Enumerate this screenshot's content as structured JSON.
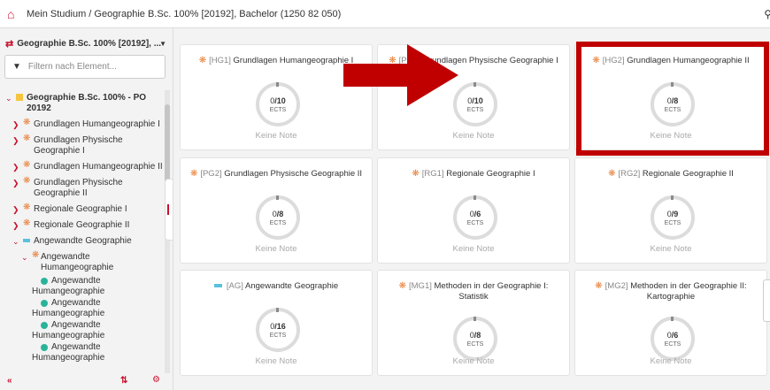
{
  "header": {
    "title": "Mein Studium / Geographie B.Sc. 100% [20192], Bachelor (1250 82 050)"
  },
  "sidebar": {
    "program_select": "Geographie B.Sc. 100% [20192], ...",
    "filter_placeholder": "Filtern nach Element...",
    "tree": [
      {
        "label": "Geographie B.Sc. 100% - PO 20192",
        "type": "folder",
        "bold": true
      },
      {
        "label": "Grundlagen Humangeographie I",
        "type": "module"
      },
      {
        "label": "Grundlagen Physische Geographie I",
        "type": "module"
      },
      {
        "label": "Grundlagen Humangeographie II",
        "type": "module"
      },
      {
        "label": "Grundlagen Physische Geographie II",
        "type": "module"
      },
      {
        "label": "Regionale Geographie I",
        "type": "module"
      },
      {
        "label": "Regionale Geographie II",
        "type": "module"
      },
      {
        "label": "Angewandte Geographie",
        "type": "group"
      },
      {
        "label": "Angewandte Humangeographie",
        "type": "module"
      },
      {
        "label": "Angewandte Humangeographie",
        "type": "course"
      },
      {
        "label": "Angewandte Humangeographie",
        "type": "course"
      },
      {
        "label": "Angewandte Humangeographie",
        "type": "course"
      },
      {
        "label": "Angewandte Humangeographie",
        "type": "course"
      }
    ]
  },
  "cards": [
    {
      "code": "[HG1]",
      "title": "Grundlagen Humangeographie I",
      "earned": "0",
      "total": "/10",
      "unit": "ECTS",
      "note": "Keine Note",
      "kind": "star"
    },
    {
      "code": "[PG1]",
      "title": "Grundlagen Physische Geographie I",
      "earned": "0",
      "total": "/10",
      "unit": "ECTS",
      "note": "Keine Note",
      "kind": "star"
    },
    {
      "code": "[HG2]",
      "title": "Grundlagen Humangeographie II",
      "earned": "0",
      "total": "/8",
      "unit": "ECTS",
      "note": "Keine Note",
      "kind": "star"
    },
    {
      "code": "[PG2]",
      "title": "Grundlagen Physische Geographie II",
      "earned": "0",
      "total": "/8",
      "unit": "ECTS",
      "note": "Keine Note",
      "kind": "star"
    },
    {
      "code": "[RG1]",
      "title": "Regionale Geographie I",
      "earned": "0",
      "total": "/6",
      "unit": "ECTS",
      "note": "Keine Note",
      "kind": "star"
    },
    {
      "code": "[RG2]",
      "title": "Regionale Geographie II",
      "earned": "0",
      "total": "/9",
      "unit": "ECTS",
      "note": "Keine Note",
      "kind": "star"
    },
    {
      "code": "[AG]",
      "title": "Angewandte Geographie",
      "earned": "0",
      "total": "/16",
      "unit": "ECTS",
      "note": "Keine Note",
      "kind": "dash"
    },
    {
      "code": "[MG1]",
      "title": "Methoden in der Geographie I: Statistik",
      "earned": "0",
      "total": "/8",
      "unit": "ECTS",
      "note": "Keine Note",
      "kind": "star"
    },
    {
      "code": "[MG2]",
      "title": "Methoden in der Geographie II: Kartographie",
      "earned": "0",
      "total": "/6",
      "unit": "ECTS",
      "note": "Keine Note",
      "kind": "star"
    }
  ],
  "colors": {
    "accent": "#c8102e",
    "highlight": "#c00000",
    "module_star": "#e8803a",
    "group": "#5bc0de",
    "course": "#2bb39a"
  }
}
